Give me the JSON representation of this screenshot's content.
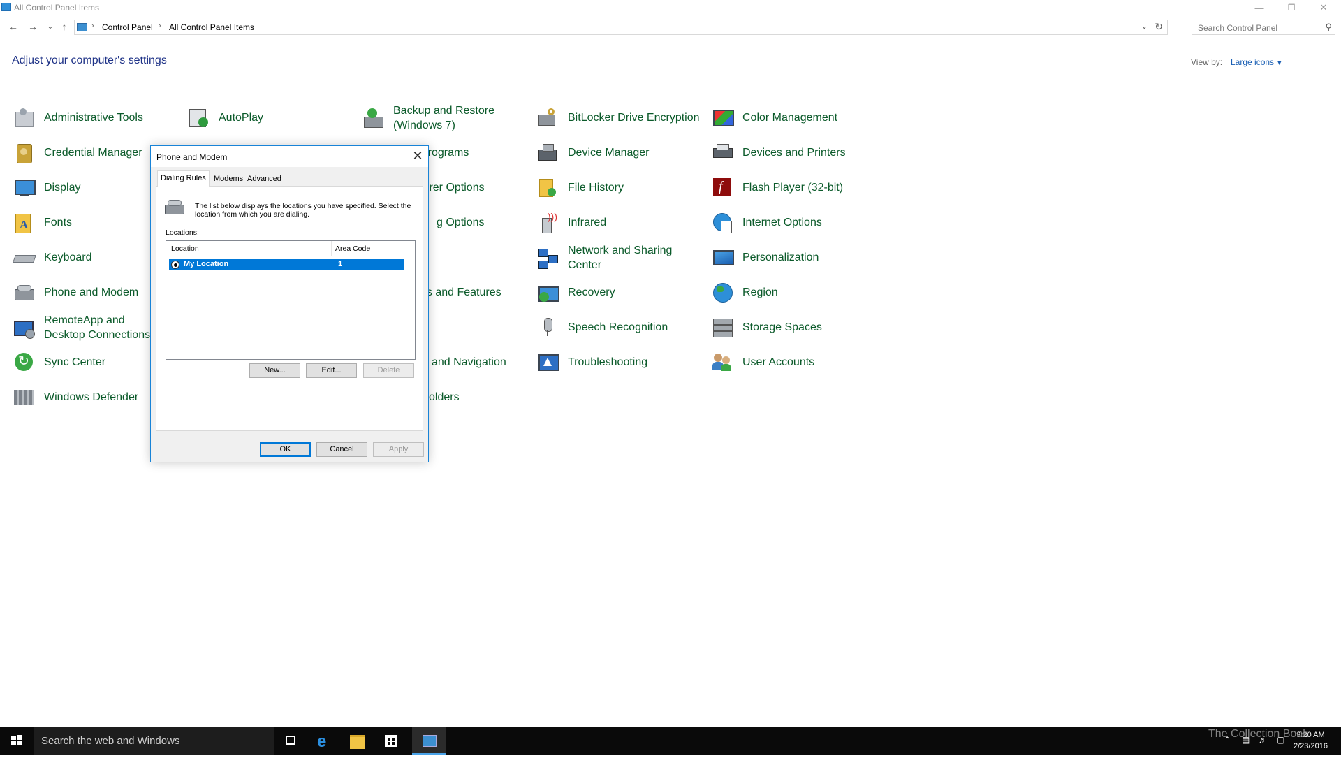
{
  "window": {
    "title": "All Control Panel Items",
    "minimize_glyph": "—",
    "maximize_glyph": "❐",
    "close_glyph": "✕"
  },
  "address_bar": {
    "breadcrumbs": [
      "Control Panel",
      "All Control Panel Items"
    ],
    "search_placeholder": "Search Control Panel"
  },
  "header": {
    "heading": "Adjust your computer's settings",
    "view_by_label": "View by:",
    "view_by_value": "Large icons"
  },
  "items": [
    {
      "label": "Administrative Tools",
      "icon": "administrative-tools-icon"
    },
    {
      "label": "AutoPlay",
      "icon": "autoplay-icon"
    },
    {
      "label": "Backup and Restore (Windows 7)",
      "icon": "backup-restore-icon"
    },
    {
      "label": "BitLocker Drive Encryption",
      "icon": "bitlocker-icon"
    },
    {
      "label": "Color Management",
      "icon": "color-management-icon"
    },
    {
      "label": "Credential Manager",
      "icon": "credential-manager-icon"
    },
    {
      "label": "Programs",
      "icon": "default-programs-icon"
    },
    {
      "label": "Device Manager",
      "icon": "device-manager-icon"
    },
    {
      "label": "Devices and Printers",
      "icon": "devices-printers-icon"
    },
    {
      "label": "Display",
      "icon": "display-icon"
    },
    {
      "label": "lorer Options",
      "icon": "file-explorer-options-icon"
    },
    {
      "label": "File History",
      "icon": "file-history-icon"
    },
    {
      "label": "Flash Player (32-bit)",
      "icon": "flash-player-icon"
    },
    {
      "label": "Fonts",
      "icon": "fonts-icon"
    },
    {
      "label": "g Options",
      "icon": "indexing-options-icon"
    },
    {
      "label": "Infrared",
      "icon": "infrared-icon"
    },
    {
      "label": "Internet Options",
      "icon": "internet-options-icon"
    },
    {
      "label": "Keyboard",
      "icon": "keyboard-icon"
    },
    {
      "label": "Network and Sharing Center",
      "icon": "network-sharing-icon"
    },
    {
      "label": "Personalization",
      "icon": "personalization-icon"
    },
    {
      "label": "Phone and Modem",
      "icon": "phone-modem-icon"
    },
    {
      "label": "ns and Features",
      "icon": "programs-features-icon"
    },
    {
      "label": "Recovery",
      "icon": "recovery-icon"
    },
    {
      "label": "Region",
      "icon": "region-icon"
    },
    {
      "label": "RemoteApp and Desktop Connections",
      "icon": "remoteapp-icon"
    },
    {
      "label": "Speech Recognition",
      "icon": "speech-recognition-icon"
    },
    {
      "label": "Storage Spaces",
      "icon": "storage-spaces-icon"
    },
    {
      "label": "Sync Center",
      "icon": "sync-center-icon"
    },
    {
      "label": "and Navigation",
      "icon": "taskbar-navigation-icon"
    },
    {
      "label": "Troubleshooting",
      "icon": "troubleshooting-icon"
    },
    {
      "label": "User Accounts",
      "icon": "user-accounts-icon"
    },
    {
      "label": "Windows Defender",
      "icon": "windows-defender-icon"
    },
    {
      "label": "olders",
      "icon": "work-folders-icon"
    }
  ],
  "dialog": {
    "title": "Phone and Modem",
    "tabs": [
      "Dialing Rules",
      "Modems",
      "Advanced"
    ],
    "active_tab": "Dialing Rules",
    "description": "The list below displays the locations you have specified. Select the location from which you are dialing.",
    "locations_label": "Locations:",
    "columns": [
      "Location",
      "Area Code"
    ],
    "rows": [
      {
        "location": "My Location",
        "area_code": "1",
        "selected": true
      }
    ],
    "list_buttons": {
      "new": "New...",
      "edit": "Edit...",
      "delete": "Delete"
    },
    "footer_buttons": {
      "ok": "OK",
      "cancel": "Cancel",
      "apply": "Apply"
    }
  },
  "taskbar": {
    "search_text": "Search the web and Windows",
    "time": "9:20 AM",
    "date": "2/23/2016",
    "watermark": "The Collection Book"
  },
  "colors": {
    "link_green": "#0b5a2a",
    "heading_blue": "#1e3287",
    "selection_blue": "#0078d7",
    "taskbar": "#0a0a0a"
  }
}
